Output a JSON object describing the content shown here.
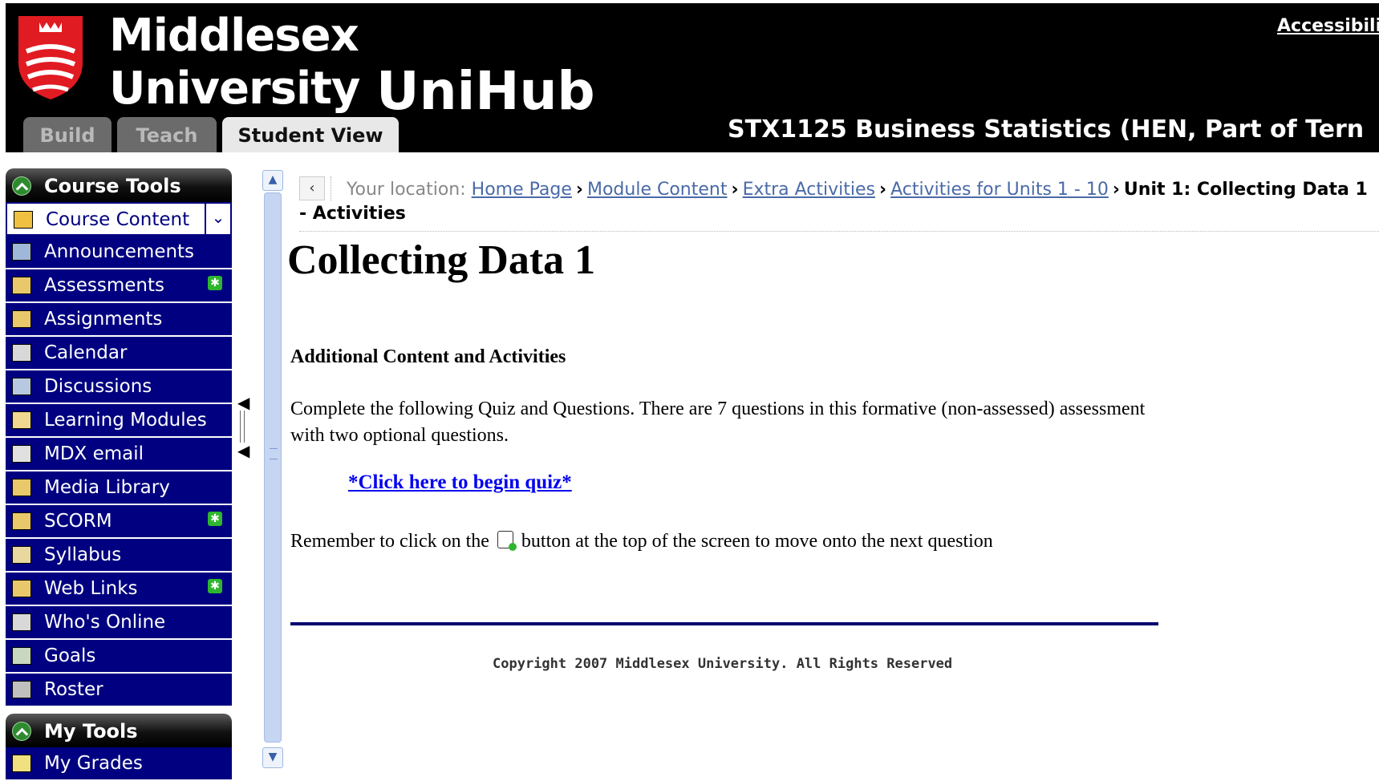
{
  "header": {
    "university_line1": "Middlesex",
    "university_line2": "University",
    "app_name": "UniHub",
    "accessibility_link": "Accessibili",
    "course_title": "STX1125 Business Statistics (HEN, Part of Tern",
    "tabs": [
      {
        "label": "Build",
        "active": false
      },
      {
        "label": "Teach",
        "active": false
      },
      {
        "label": "Student View",
        "active": true
      }
    ],
    "brand_color": "#e11b22"
  },
  "sidebar": {
    "course_tools_title": "Course Tools",
    "items": [
      {
        "label": "Course Content",
        "icon": "home-icon",
        "current": true,
        "new": false
      },
      {
        "label": "Announcements",
        "icon": "megaphone-icon",
        "current": false,
        "new": false
      },
      {
        "label": "Assessments",
        "icon": "assessment-icon",
        "current": false,
        "new": true
      },
      {
        "label": "Assignments",
        "icon": "assignment-icon",
        "current": false,
        "new": false
      },
      {
        "label": "Calendar",
        "icon": "calendar-icon",
        "current": false,
        "new": false
      },
      {
        "label": "Discussions",
        "icon": "discussion-icon",
        "current": false,
        "new": false
      },
      {
        "label": "Learning Modules",
        "icon": "module-icon",
        "current": false,
        "new": false
      },
      {
        "label": "MDX email",
        "icon": "email-icon",
        "current": false,
        "new": false
      },
      {
        "label": "Media Library",
        "icon": "media-icon",
        "current": false,
        "new": false
      },
      {
        "label": "SCORM",
        "icon": "scorm-icon",
        "current": false,
        "new": true
      },
      {
        "label": "Syllabus",
        "icon": "syllabus-icon",
        "current": false,
        "new": false
      },
      {
        "label": "Web Links",
        "icon": "weblink-icon",
        "current": false,
        "new": true
      },
      {
        "label": "Who's Online",
        "icon": "online-icon",
        "current": false,
        "new": false
      },
      {
        "label": "Goals",
        "icon": "goals-icon",
        "current": false,
        "new": false
      },
      {
        "label": "Roster",
        "icon": "roster-icon",
        "current": false,
        "new": false
      }
    ],
    "my_tools_title": "My Tools",
    "my_tools_items": [
      {
        "label": "My Grades",
        "icon": "grades-icon"
      }
    ],
    "nav_color": "#000080"
  },
  "breadcrumb": {
    "prefix": "Your location:",
    "links": [
      "Home Page",
      "Module Content",
      "Extra Activities",
      "Activities for Units 1 - 10"
    ],
    "current": "Unit 1: Collecting Data 1 - Activities",
    "separator": "›"
  },
  "content": {
    "title": "Collecting Data 1",
    "subheading": "Additional Content and Activities",
    "paragraph": "Complete the following Quiz and Questions. There are 7 questions in this formative (non-assessed) assessment with two optional questions.",
    "quiz_link": "*Click here to begin quiz*",
    "remember_before": "Remember to click on the",
    "remember_after": "button at the top of the screen to move onto the next question",
    "copyright": "Copyright 2007 Middlesex University. All Rights Reserved"
  }
}
